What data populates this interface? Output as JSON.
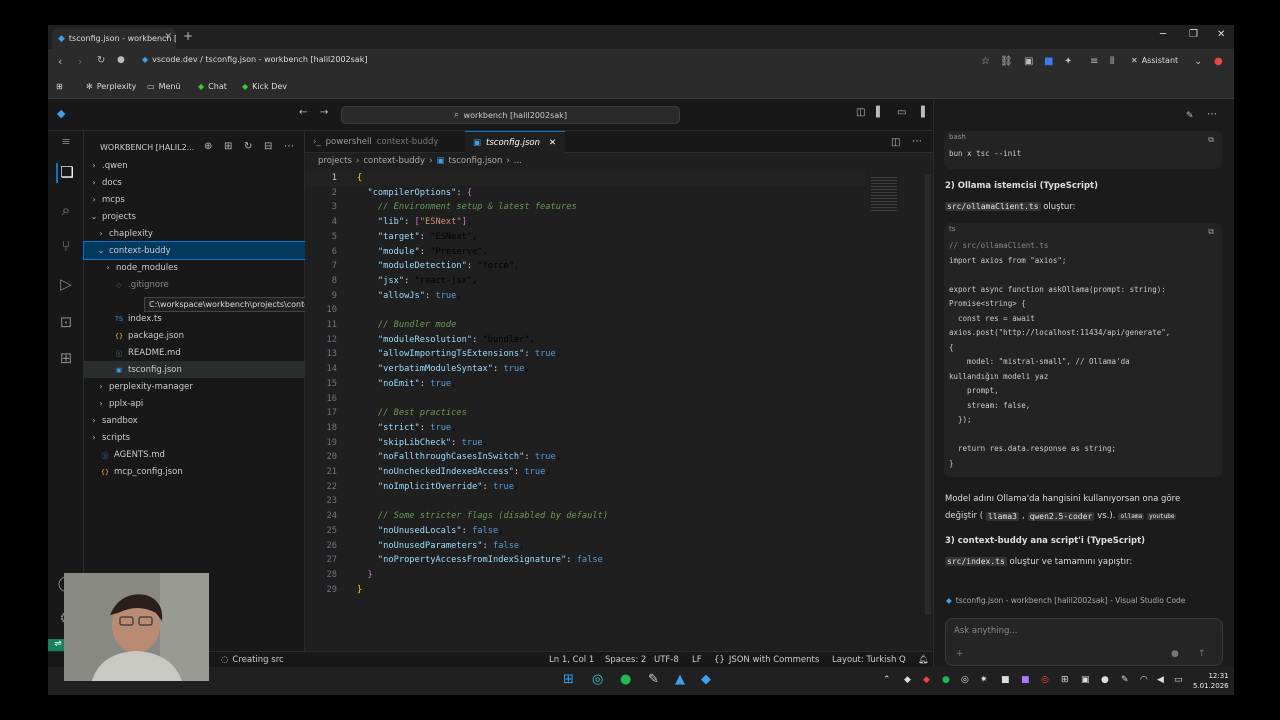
{
  "browser": {
    "tab_title": "tsconfig.json - workbench [h...",
    "url_prefix": "vscode.dev / tsconfig.json - workbench [halil2002sak]",
    "assistant_label": "Assistant",
    "bookmarks": [
      "Perplexity",
      "Menü",
      "Chat",
      "Kick Dev"
    ]
  },
  "vscode": {
    "search_text": "workbench [halil2002sak]",
    "explorer_title": "WORKBENCH [HALIL2...",
    "tree": [
      {
        "label": ".qwen",
        "indent": 1,
        "type": "folder",
        "open": false
      },
      {
        "label": "docs",
        "indent": 1,
        "type": "folder",
        "open": false
      },
      {
        "label": "mcps",
        "indent": 1,
        "type": "folder",
        "open": false
      },
      {
        "label": "projects",
        "indent": 1,
        "type": "folder",
        "open": true
      },
      {
        "label": "chaplexity",
        "indent": 2,
        "type": "folder",
        "open": false
      },
      {
        "label": "context-buddy",
        "indent": 2,
        "type": "folder",
        "open": true,
        "selected": true
      },
      {
        "label": "node_modules",
        "indent": 3,
        "type": "folder",
        "open": false
      },
      {
        "label": ".gitignore",
        "indent": 3,
        "type": "gitignore"
      },
      {
        "label": "",
        "indent": 3,
        "type": "hidden"
      },
      {
        "label": "index.ts",
        "indent": 3,
        "type": "ts"
      },
      {
        "label": "package.json",
        "indent": 3,
        "type": "json"
      },
      {
        "label": "README.md",
        "indent": 3,
        "type": "md"
      },
      {
        "label": "tsconfig.json",
        "indent": 3,
        "type": "tsconfig",
        "active": true
      },
      {
        "label": "perplexity-manager",
        "indent": 2,
        "type": "folder",
        "open": false
      },
      {
        "label": "pplx-api",
        "indent": 2,
        "type": "folder",
        "open": false
      },
      {
        "label": "sandbox",
        "indent": 1,
        "type": "folder",
        "open": false
      },
      {
        "label": "scripts",
        "indent": 1,
        "type": "folder",
        "open": false
      },
      {
        "label": "AGENTS.md",
        "indent": 1,
        "type": "md"
      },
      {
        "label": "mcp_config.json",
        "indent": 1,
        "type": "json"
      }
    ],
    "tooltip": "C:\\workspace\\workbench\\projects\\context-buddy\\.gitignore",
    "tabs": [
      {
        "label": "powershell",
        "desc": "context-buddy"
      },
      {
        "label": "tsconfig.json",
        "desc": ""
      }
    ],
    "breadcrumb": [
      "projects",
      "context-buddy",
      "tsconfig.json",
      "..."
    ],
    "status": {
      "task": "Creating src",
      "position": "Ln 1, Col 1",
      "spaces": "Spaces: 2",
      "encoding": "UTF-8",
      "eol": "LF",
      "language": "JSON with Comments",
      "layout": "Layout: Turkish Q"
    }
  },
  "code": [
    "{",
    "  \"compilerOptions\": {",
    "    // Environment setup & latest features",
    "    \"lib\": [\"ESNext\"],",
    "    \"target\": \"ESNext\",",
    "    \"module\": \"Preserve\",",
    "    \"moduleDetection\": \"force\",",
    "    \"jsx\": \"react-jsx\",",
    "    \"allowJs\": true,",
    "",
    "    // Bundler mode",
    "    \"moduleResolution\": \"bundler\",",
    "    \"allowImportingTsExtensions\": true,",
    "    \"verbatimModuleSyntax\": true,",
    "    \"noEmit\": true,",
    "",
    "    // Best practices",
    "    \"strict\": true,",
    "    \"skipLibCheck\": true,",
    "    \"noFallthroughCasesInSwitch\": true,",
    "    \"noUncheckedIndexedAccess\": true,",
    "    \"noImplicitOverride\": true,",
    "",
    "    // Some stricter flags (disabled by default)",
    "    \"noUnusedLocals\": false,",
    "    \"noUnusedParameters\": false,",
    "    \"noPropertyAccessFromIndexSignature\": false",
    "  }",
    "}"
  ],
  "assistant": {
    "block1_lang": "bash",
    "block1_code": "bun x tsc --init",
    "heading2": "2) Ollama istemcisi (TypeScript)",
    "file2": "src/ollamaClient.ts",
    "file2_suffix": " oluştur:",
    "block2_lang": "ts",
    "block2_lines": [
      "// src/ollamaClient.ts",
      "import axios from \"axios\";",
      "",
      "export async function askOllama(prompt: string):",
      "Promise<string> {",
      "  const res = await",
      "axios.post(\"http://localhost:11434/api/generate\",",
      "{",
      "    model: \"mistral-small\", // Ollama'da",
      "kullandığın modeli yaz",
      "    prompt,",
      "    stream: false,",
      "  });",
      "",
      "  return res.data.response as string;",
      "}"
    ],
    "para1": "Model adını Ollama'da hangisini kullanıyorsan ona göre",
    "para2_prefix": "değiştir (",
    "para2_code1": "llama3",
    "para2_code2": "qwen2.5-coder",
    "para2_suffix": " vs.).",
    "tag1": "ollama",
    "tag2": "youtube",
    "heading3": "3) context-buddy ana script'i (TypeScript)",
    "file3": "src/index.ts",
    "file3_suffix": " oluştur ve tamamını yapıştır:",
    "context_chip": "tsconfig.json - workbench [halil2002sak] - Visual Studio Code",
    "ask_placeholder": "Ask anything..."
  },
  "taskbar": {
    "time": "12:31",
    "date": "5.01.2026"
  }
}
